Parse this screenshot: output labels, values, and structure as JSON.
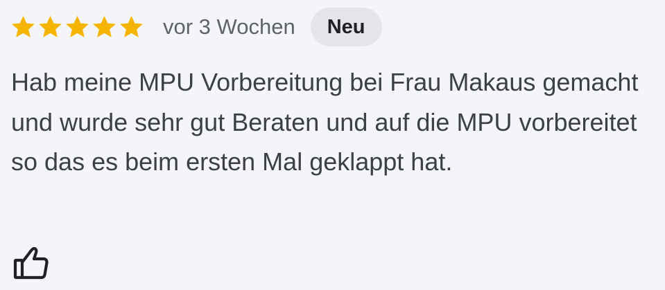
{
  "review": {
    "rating": 5,
    "rating_max": 5,
    "star_color": "#f4b400",
    "time_ago": "vor 3 Wochen",
    "badge": "Neu",
    "text": "Hab meine MPU Vorbereitung bei Frau Makaus gemacht und wurde sehr gut Beraten und auf die MPU vorbereitet so das es beim ersten Mal geklappt hat.",
    "like_icon": "thumb-up-outline-icon"
  }
}
